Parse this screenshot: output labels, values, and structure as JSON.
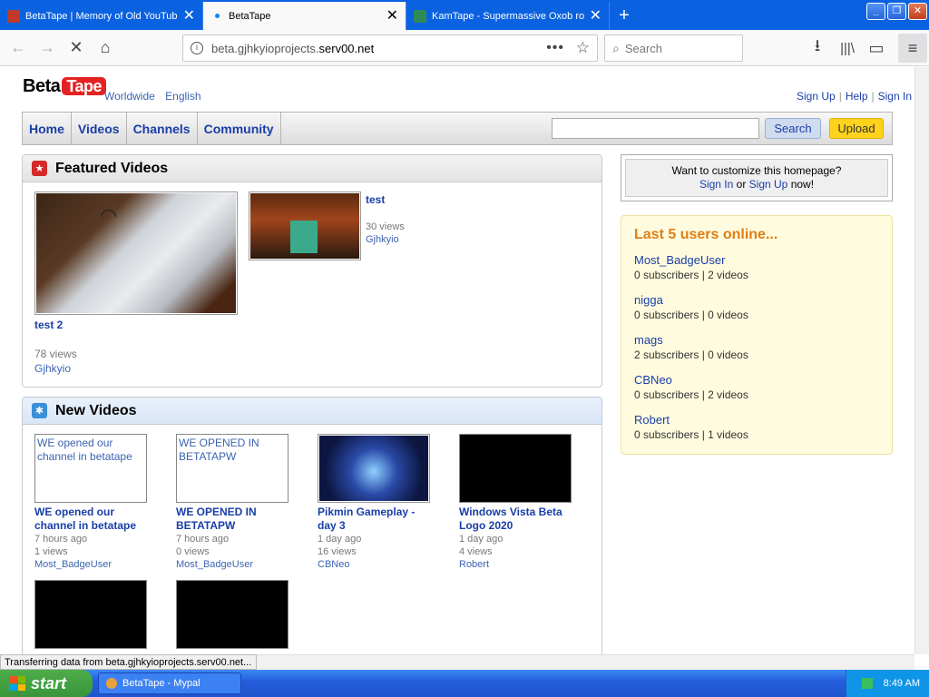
{
  "browser": {
    "tabs": [
      {
        "title": "BetaTape | Memory of Old YouTube",
        "favicon_color": "#c0392b"
      },
      {
        "title": "BetaTape",
        "favicon_color": "#0a84ff"
      },
      {
        "title": "KamTape - Supermassive Oxob ro",
        "favicon_color": "#2e8b57"
      }
    ],
    "url": {
      "prefix": "beta.gjhkyioprojects.",
      "domain": "serv00.net"
    },
    "search_placeholder": "Search",
    "status_text": "Transferring data from beta.gjhkyioprojects.serv00.net..."
  },
  "site": {
    "logo": {
      "beta": "Beta",
      "tape": "Tape"
    },
    "region": {
      "worldwide": "Worldwide",
      "language": "English"
    },
    "toplinks": {
      "signup": "Sign Up",
      "help": "Help",
      "signin": "Sign In"
    },
    "nav": [
      {
        "label": "Home"
      },
      {
        "label": "Videos"
      },
      {
        "label": "Channels"
      },
      {
        "label": "Community"
      }
    ],
    "search_button": "Search",
    "upload_button": "Upload"
  },
  "featured": {
    "title": "Featured Videos",
    "videos": [
      {
        "title": "test 2",
        "views": "78 views",
        "user": "Gjhkyio"
      },
      {
        "title": "test",
        "views": "30 views",
        "user": "Gjhkyio"
      }
    ]
  },
  "newvideos": {
    "title": "New Videos",
    "videos": [
      {
        "thumb_text": "WE opened our channel in betatape",
        "title": "WE opened our channel in betatape",
        "age": "7 hours ago",
        "views": "1 views",
        "user": "Most_BadgeUser"
      },
      {
        "thumb_text": "WE OPENED IN BETATAPW",
        "title": "WE OPENED IN BETATAPW",
        "age": "7 hours ago",
        "views": "0 views",
        "user": "Most_BadgeUser"
      },
      {
        "thumb_text": "",
        "title": "Pikmin Gameplay - day 3",
        "age": "1 day ago",
        "views": "16 views",
        "user": "CBNeo"
      },
      {
        "thumb_text": "",
        "title": "Windows Vista Beta Logo 2020",
        "age": "1 day ago",
        "views": "4 views",
        "user": "Robert"
      }
    ]
  },
  "customize": {
    "question": "Want to customize this homepage?",
    "signin": "Sign In",
    "or": "or",
    "signup": "Sign Up",
    "now": "now!"
  },
  "online": {
    "title": "Last 5 users online...",
    "users": [
      {
        "name": "Most_BadgeUser",
        "stats": "0 subscribers | 2 videos"
      },
      {
        "name": "nigga",
        "stats": "0 subscribers | 0 videos"
      },
      {
        "name": "mags",
        "stats": "2 subscribers | 0 videos"
      },
      {
        "name": "CBNeo",
        "stats": "0 subscribers | 2 videos"
      },
      {
        "name": "Robert",
        "stats": "0 subscribers | 1 videos"
      }
    ]
  },
  "taskbar": {
    "start": "start",
    "item": "BetaTape - Mypal",
    "clock": "8:49 AM"
  }
}
